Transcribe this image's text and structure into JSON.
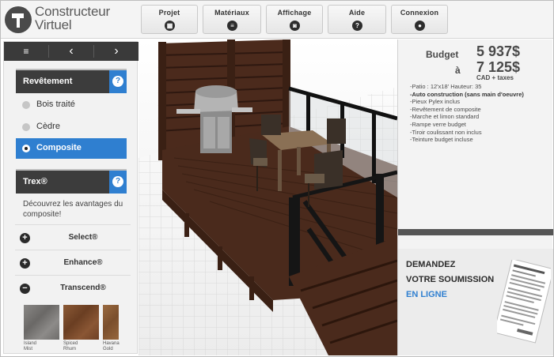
{
  "header": {
    "logo_line1": "Constructeur",
    "logo_line2": "Virtuel",
    "nav": [
      {
        "label": "Projet",
        "icon": "grid-icon",
        "glyph": "▦"
      },
      {
        "label": "Matériaux",
        "icon": "list-icon",
        "glyph": "≡"
      },
      {
        "label": "Affichage",
        "icon": "camera-icon",
        "glyph": "◙"
      },
      {
        "label": "Aide",
        "icon": "help-icon",
        "glyph": "?"
      },
      {
        "label": "Connexion",
        "icon": "user-icon",
        "glyph": "●"
      }
    ]
  },
  "pager": {
    "menu_glyph": "≡",
    "prev_glyph": "‹",
    "next_glyph": "›"
  },
  "revetement": {
    "title": "Revêtement",
    "help_glyph": "?",
    "options": [
      {
        "label": "Bois traité",
        "selected": false
      },
      {
        "label": "Cèdre",
        "selected": false
      },
      {
        "label": "Composite",
        "selected": true
      }
    ]
  },
  "trex": {
    "title": "Trex®",
    "help_glyph": "?",
    "description": "Découvrez les avantages du composite!",
    "items": [
      {
        "sign": "+",
        "label": "Select®"
      },
      {
        "sign": "+",
        "label": "Enhance®"
      },
      {
        "sign": "−",
        "label": "Transcend®"
      }
    ],
    "swatches": [
      {
        "line1": "Island",
        "line2": "Mist",
        "color": "#7b7a78"
      },
      {
        "line1": "Spiced",
        "line2": "Rhum",
        "color": "#7a4a2a"
      },
      {
        "line1": "Havana",
        "line2": "Gold",
        "color": "#8a5a32"
      }
    ]
  },
  "budget": {
    "label": "Budget",
    "from": "5 937$",
    "connector": "à",
    "to": "7 125$",
    "tax_note": "CAD + taxes",
    "specs": [
      {
        "text": "-Patio : 12'x18'  Hauteur: 35",
        "bold": false
      },
      {
        "text": "-Auto construction (sans main d'oeuvre)",
        "bold": true
      },
      {
        "text": "-Pieux Pylex inclus",
        "bold": false
      },
      {
        "text": "-Revêtement de composite",
        "bold": false
      },
      {
        "text": "-Marche et limon standard",
        "bold": false
      },
      {
        "text": "-Rampe verre budget",
        "bold": false
      },
      {
        "text": "-Tiroir coulissant non inclus",
        "bold": false
      },
      {
        "text": "-Teinture budget incluse",
        "bold": false
      }
    ]
  },
  "quote": {
    "line1": "DEMANDEZ",
    "line2": "VOTRE SOUMISSION",
    "line3": "EN LIGNE"
  },
  "colors": {
    "accent": "#2f7fd0",
    "dark_header": "#3c3c3c",
    "deck_wood": "#4a2a1c"
  }
}
